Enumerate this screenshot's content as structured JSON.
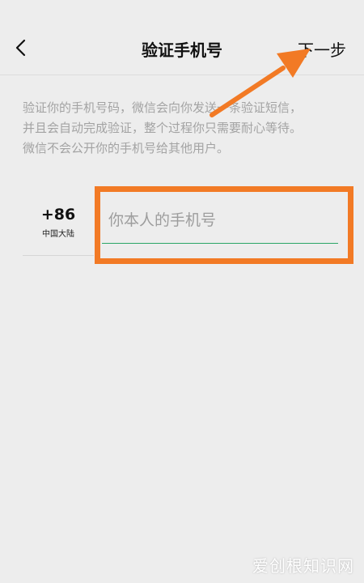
{
  "header": {
    "title": "验证手机号",
    "next_label": "下一步",
    "back_icon": "chevron-left-icon"
  },
  "description": {
    "lines": [
      "验证你的手机号码，微信会向你发送一条验证短信，",
      "并且会自动完成验证，整个过程你只需要耐心等待。",
      "微信不会公开你的手机号给其他用户。"
    ]
  },
  "phone": {
    "country_code": "+86",
    "country_name": "中国大陆",
    "placeholder": "你本人的手机号",
    "value": ""
  },
  "annotation": {
    "color": "#f27a25"
  },
  "watermark": {
    "text": "爱创根知识网"
  },
  "colors": {
    "background": "#ededed",
    "accent": "#2aa566",
    "annotation": "#f27a25"
  }
}
